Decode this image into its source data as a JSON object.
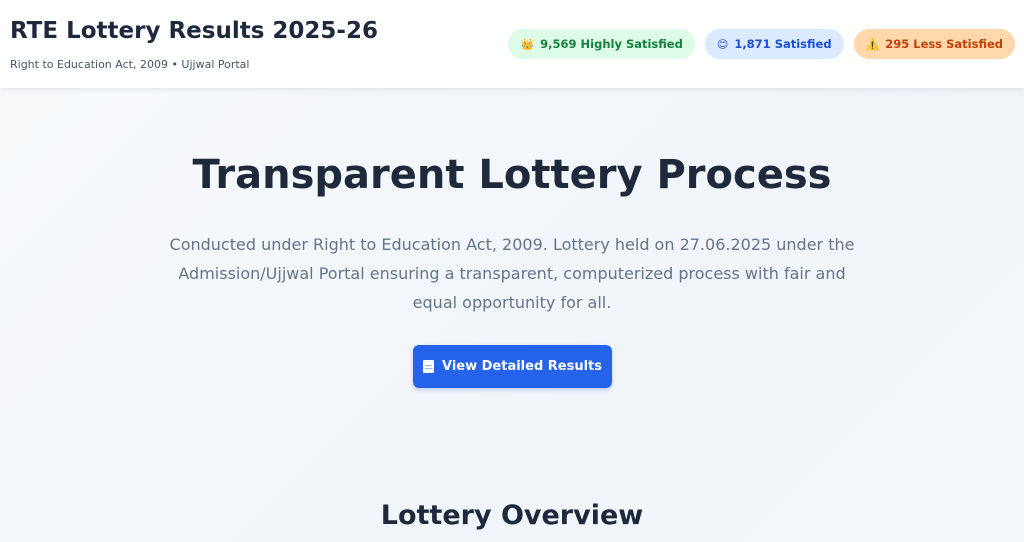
{
  "header": {
    "title": "RTE Lottery Results 2025-26",
    "subtitle": "Right to Education Act, 2009 • Ujjwal Portal",
    "badges": [
      {
        "icon": "crown-icon",
        "glyph": "👑",
        "label": "9,569 Highly Satisfied",
        "color": "#15803d"
      },
      {
        "icon": "smiley-icon",
        "glyph": "😊",
        "label": "1,871 Satisfied",
        "color": "#1d4ed8"
      },
      {
        "icon": "warning-icon",
        "glyph": "⚠️",
        "label": "295 Less Satisfied",
        "color": "#c2410c"
      }
    ]
  },
  "hero": {
    "title": "Transparent Lottery Process",
    "description": "Conducted under Right to Education Act, 2009. Lottery held on 27.06.2025 under the Admission/Ujjwal Portal ensuring a transparent, computerized process with fair and equal opportunity for all.",
    "cta_label": "View Detailed Results",
    "cta_icon": "document-icon",
    "accent": "#2563eb"
  },
  "overview": {
    "title": "Lottery Overview"
  }
}
